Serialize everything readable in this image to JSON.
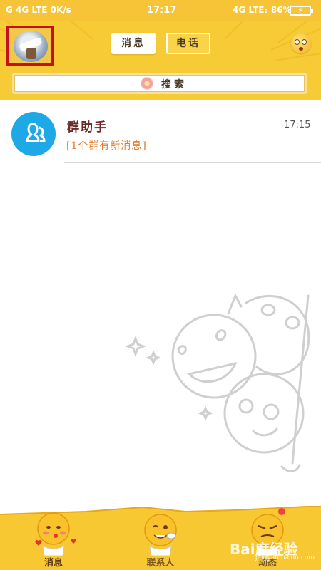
{
  "status_bar": {
    "left": "G  4G LTE  0K/s",
    "time": "17:17",
    "right": "4G LTE₂ 86%"
  },
  "header": {
    "tabs": [
      {
        "label": "消息",
        "active": true
      },
      {
        "label": "电话",
        "active": false
      }
    ],
    "search": {
      "label": "搜索"
    }
  },
  "messages": [
    {
      "title": "群助手",
      "subtitle": "[1个群有新消息]",
      "time": "17:15",
      "icon": "group-icon"
    }
  ],
  "bottom_nav": [
    {
      "label": "消息",
      "icon": "smiley-kiss-icon",
      "active": true
    },
    {
      "label": "联系人",
      "icon": "smiley-wink-icon",
      "active": false
    },
    {
      "label": "动态",
      "icon": "smiley-cool-icon",
      "active": false,
      "badge": true
    }
  ],
  "watermark": {
    "text": "Bai度经验",
    "sub": "jingyan.baidu.com"
  },
  "colors": {
    "header": "#f7cb36",
    "accent_red": "#c4121b",
    "group_icon": "#1ea8e6",
    "subtitle": "#e07b2a"
  }
}
